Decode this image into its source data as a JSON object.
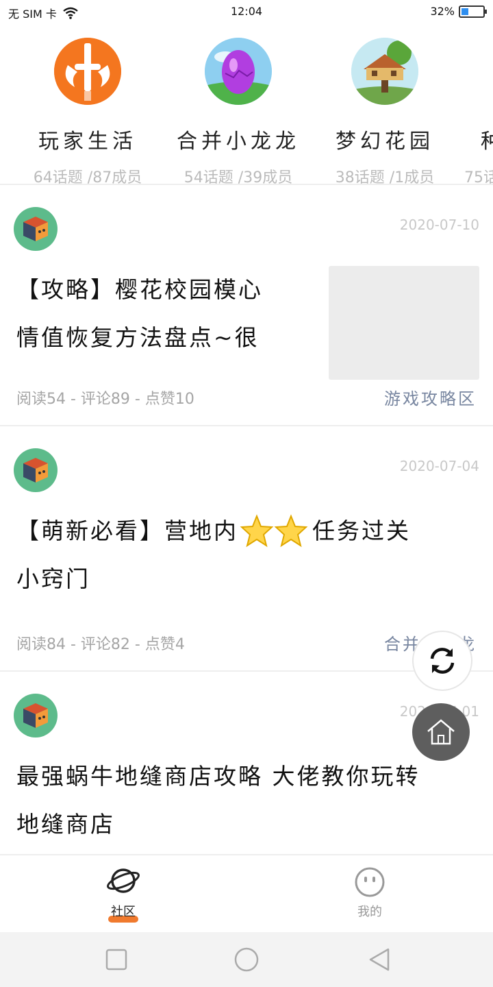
{
  "status_bar": {
    "carrier": "无 SIM 卡",
    "time": "12:04",
    "battery": "32%",
    "battery_level": 0.32
  },
  "groups": [
    {
      "name": "玩家生活",
      "meta": "64话题 /87成员",
      "icon": "sword-logo-icon"
    },
    {
      "name": "合并小龙龙",
      "meta": "54话题 /39成员",
      "icon": "dragon-egg-icon"
    },
    {
      "name": "梦幻花园",
      "meta": "38话题 /1成员",
      "icon": "treehouse-icon"
    },
    {
      "name": "种",
      "meta": "75话",
      "icon": "partial-group-icon"
    }
  ],
  "posts": [
    {
      "date": "2020-07-10",
      "title_line1": "【攻略】樱花校园模心",
      "title_line2": "情值恢复方法盘点~很",
      "stats": "阅读54 - 评论89 - 点赞10",
      "category": "游戏攻略区"
    },
    {
      "date": "2020-07-04",
      "title_line1_a": "【萌新必看】营地内",
      "title_line1_b": "任务过关",
      "title_line2": "小窍门",
      "stats": "阅读84 - 评论82 - 点赞4",
      "category": "合并小龙龙"
    },
    {
      "date": "2020-07-01",
      "title_line1": "最强蜗牛地缝商店攻略 大佬教你玩转",
      "title_line2": "地缝商店"
    }
  ],
  "tabbar": {
    "community": "社区",
    "mine": "我的",
    "active_color": "#f07a2e"
  },
  "colors": {
    "avatar_bg": "#5dbb8b",
    "category_text": "#7886a0"
  }
}
